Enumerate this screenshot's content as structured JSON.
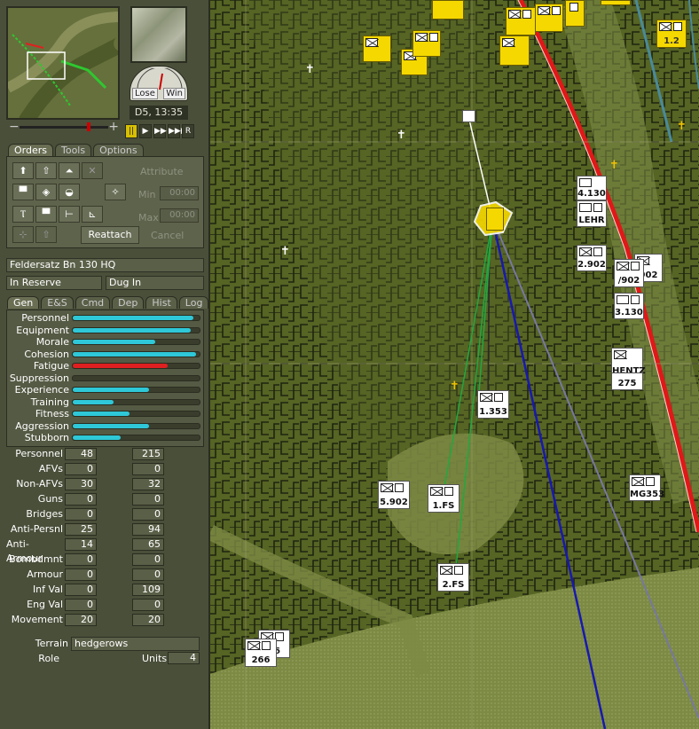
{
  "header": {
    "datetime": "D5, 13:35",
    "gauge_lose": "Lose",
    "gauge_win": "Win"
  },
  "tabs": {
    "orders": "Orders",
    "tools": "Tools",
    "options": "Options"
  },
  "playback": {
    "pause": "||",
    "play": "▶",
    "ff": "▶▶",
    "fff": "▶▶▶",
    "r": "R"
  },
  "orders_panel": {
    "reattach": "Reattach",
    "attribute": "Attribute",
    "cancel": "Cancel",
    "min_label": "Min",
    "min_value": "00:00",
    "max_label": "Max",
    "max_value": "00:00"
  },
  "unit": {
    "name": "Feldersatz Bn 130 HQ",
    "status": "In Reserve",
    "posture": "Dug In"
  },
  "subtabs": [
    "Gen",
    "E&S",
    "Cmd",
    "Dep",
    "Hist",
    "Log"
  ],
  "attributes": [
    {
      "name": "Personnel",
      "value": 0.95,
      "color": "#2ec8d8"
    },
    {
      "name": "Equipment",
      "value": 0.93,
      "color": "#2ec8d8"
    },
    {
      "name": "Morale",
      "value": 0.65,
      "color": "#2ec8d8"
    },
    {
      "name": "Cohesion",
      "value": 0.97,
      "color": "#2ec8d8"
    },
    {
      "name": "Fatigue",
      "value": 0.75,
      "color": "#e02020"
    },
    {
      "name": "Suppression",
      "value": 0.0,
      "color": "#2ec8d8"
    },
    {
      "name": "Experience",
      "value": 0.6,
      "color": "#2ec8d8"
    },
    {
      "name": "Training",
      "value": 0.32,
      "color": "#2ec8d8"
    },
    {
      "name": "Fitness",
      "value": 0.45,
      "color": "#2ec8d8"
    },
    {
      "name": "Aggression",
      "value": 0.6,
      "color": "#2ec8d8"
    },
    {
      "name": "Stubborn",
      "value": 0.38,
      "color": "#2ec8d8"
    }
  ],
  "stats": [
    {
      "name": "Personnel",
      "a": "48",
      "b": "215"
    },
    {
      "name": "AFVs",
      "a": "0",
      "b": "0"
    },
    {
      "name": "Non-AFVs",
      "a": "30",
      "b": "32"
    },
    {
      "name": "Guns",
      "a": "0",
      "b": "0"
    },
    {
      "name": "Bridges",
      "a": "0",
      "b": "0"
    },
    {
      "name": "Anti-Persnl",
      "a": "25",
      "b": "94"
    },
    {
      "name": "Anti-Armour",
      "a": "14",
      "b": "65"
    },
    {
      "name": "Bombdmnt",
      "a": "0",
      "b": "0"
    },
    {
      "name": "Armour",
      "a": "0",
      "b": "0"
    },
    {
      "name": "Inf Val",
      "a": "0",
      "b": "109"
    },
    {
      "name": "Eng Val",
      "a": "0",
      "b": "0"
    },
    {
      "name": "Movement",
      "a": "20",
      "b": "20"
    }
  ],
  "terrain": {
    "label": "Terrain",
    "value": "hedgerows"
  },
  "role": {
    "label": "Role",
    "units_label": "Units",
    "units_value": "4"
  },
  "map_units": [
    {
      "label": "4.130"
    },
    {
      "label": "LEHR"
    },
    {
      "label": "2.902"
    },
    {
      "label": "902"
    },
    {
      "label": "/902"
    },
    {
      "label": "3.130"
    },
    {
      "label": "HENTZ"
    },
    {
      "label": "275"
    },
    {
      "label": "1.353"
    },
    {
      "label": "5.902"
    },
    {
      "label": "1.FS"
    },
    {
      "label": "MG353"
    },
    {
      "label": "2.FS"
    },
    {
      "label": "266"
    },
    {
      "label": "66"
    },
    {
      "label": "1.2"
    }
  ],
  "colors": {
    "panel": "#4a4f3a",
    "map": "#4d5a23",
    "road": "#e01818",
    "friendly": "#f5d800"
  }
}
